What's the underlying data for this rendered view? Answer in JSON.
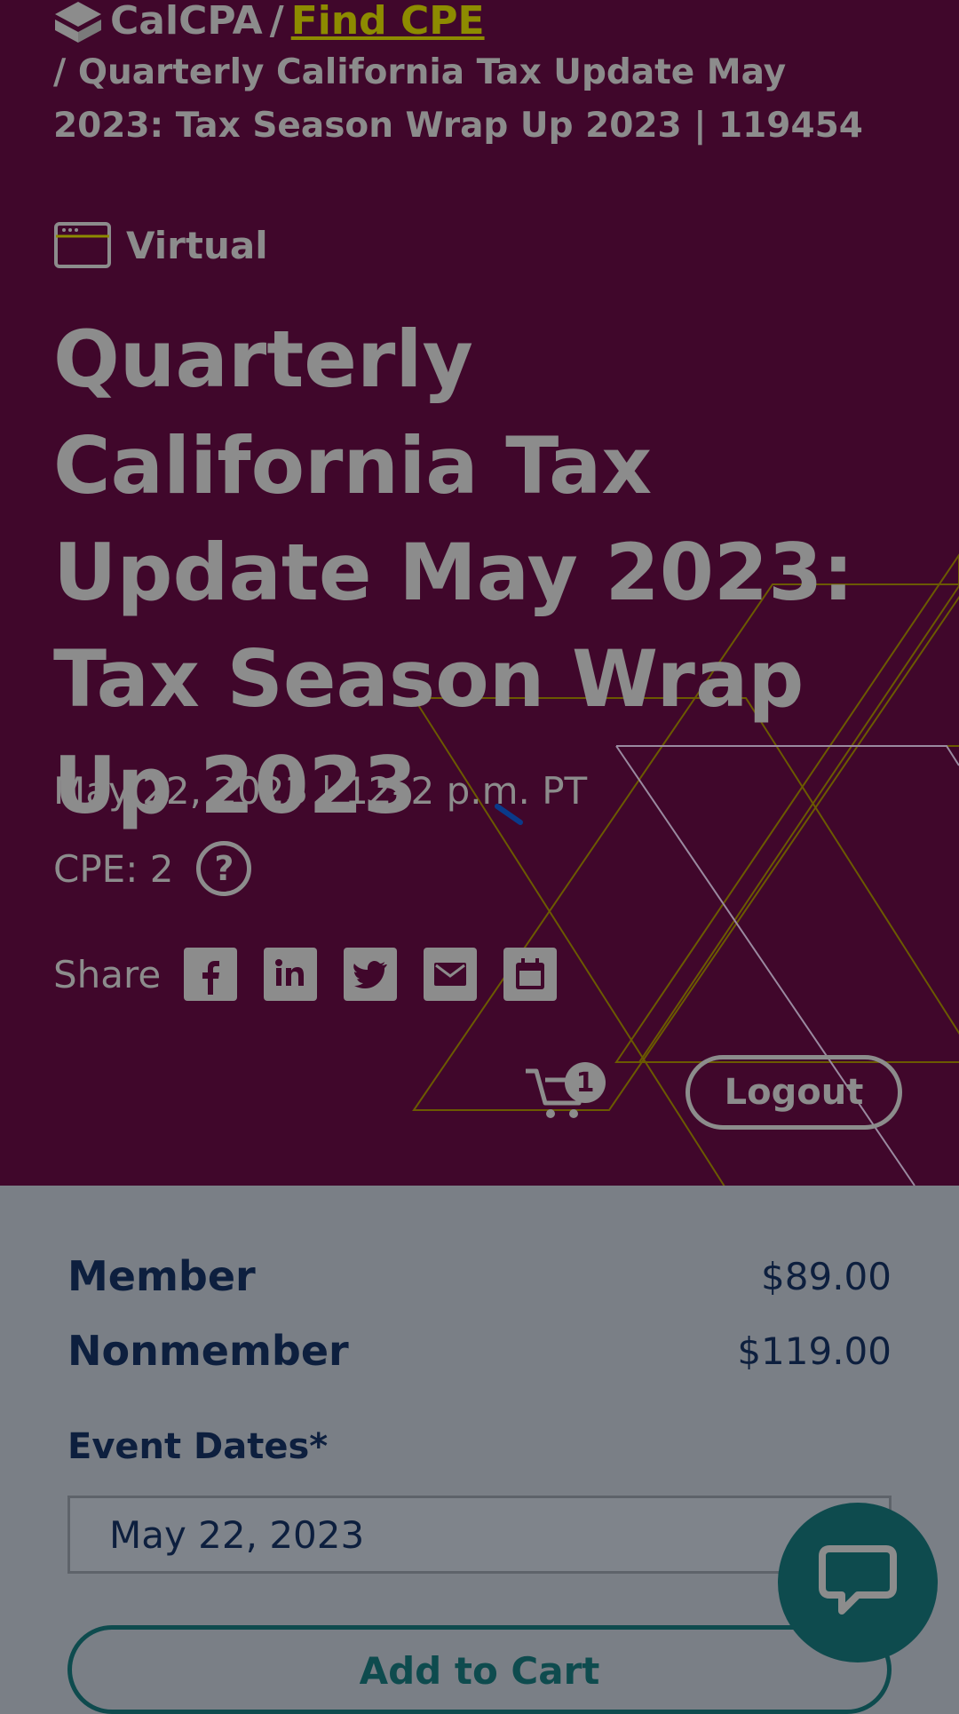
{
  "breadcrumb": {
    "brand": "CalCPA",
    "separator": "/",
    "find_link": "Find CPE",
    "current": "/ Quarterly California Tax Update May 2023: Tax Season Wrap Up 2023 | 119454"
  },
  "event": {
    "format_label": "Virtual",
    "title": "Quarterly California Tax Update May 2023: Tax Season Wrap Up 2023",
    "dateline": "May 22, 2023 | 12–2 p.m. PT",
    "cpe_label": "CPE: 2",
    "help_glyph": "?",
    "share_label": "Share",
    "share_icons": [
      "facebook-icon",
      "linkedin-icon",
      "twitter-icon",
      "email-icon",
      "calendar-icon"
    ]
  },
  "header_actions": {
    "cart_count": "1",
    "logout_label": "Logout"
  },
  "pricing": {
    "member_label": "Member",
    "member_price": "$89.00",
    "nonmember_label": "Nonmember",
    "nonmember_price": "$119.00"
  },
  "purchase": {
    "event_dates_label": "Event Dates*",
    "selected_date": "May 22, 2023",
    "add_to_cart_label": "Add to Cart"
  },
  "colors": {
    "hero_bg": "#40072b",
    "overlay_text": "#8c8c8c",
    "accent_link": "#8d8b00",
    "navy": "#0d1f3e",
    "teal": "#0e4b4e",
    "panel_bg": "#7a7f86"
  }
}
